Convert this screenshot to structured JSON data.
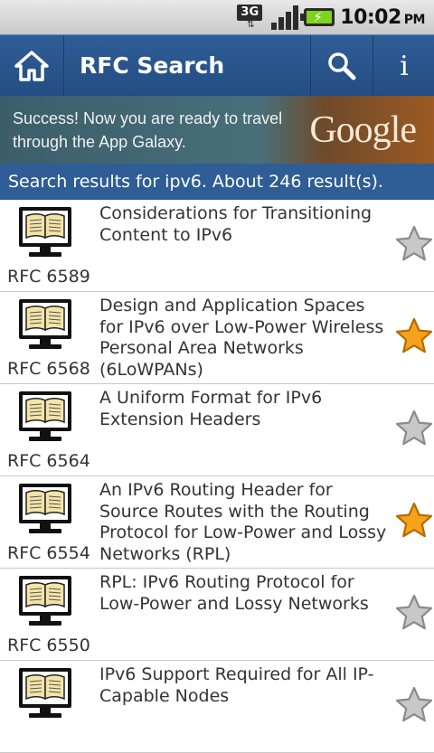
{
  "status_bar": {
    "network": "3G",
    "time": "10:02",
    "ampm": "PM"
  },
  "app_bar": {
    "title": "RFC Search",
    "info_label": "i"
  },
  "ad": {
    "text": "Success! Now you are ready to travel through the App Galaxy.",
    "logo": "Google"
  },
  "results": {
    "header": "Search results for ipv6. About 246 result(s).",
    "items": [
      {
        "number": "RFC 6589",
        "title": "Considerations for Transitioning Content to IPv6",
        "starred": false
      },
      {
        "number": "RFC 6568",
        "title": "Design and Application Spaces for IPv6 over Low-Power Wireless Personal Area Networks (6LoWPANs)",
        "starred": true
      },
      {
        "number": "RFC 6564",
        "title": "A Uniform Format for IPv6 Extension Headers",
        "starred": false
      },
      {
        "number": "RFC 6554",
        "title": "An IPv6 Routing Header for Source Routes with the Routing Protocol for Low-Power and Lossy Networks (RPL)",
        "starred": true
      },
      {
        "number": "RFC 6550",
        "title": "RPL: IPv6 Routing Protocol for Low-Power and Lossy Networks",
        "starred": false
      },
      {
        "number": "",
        "title": "IPv6 Support Required for All IP-Capable Nodes",
        "starred": false
      }
    ]
  },
  "colors": {
    "app_bar": "#2f5d96",
    "star_on": "#f7a21b",
    "star_off": "#c8c8c8"
  },
  "icons": {
    "home": "home-icon",
    "search": "search-icon",
    "book": "book-monitor-icon",
    "star": "star-icon"
  }
}
